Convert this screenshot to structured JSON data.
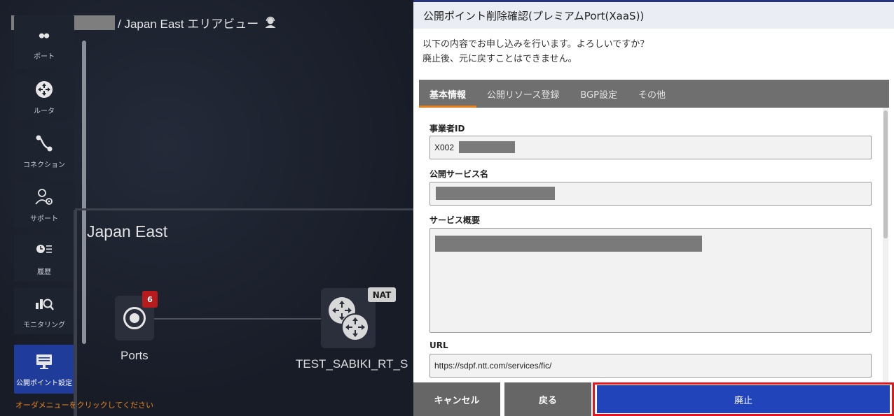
{
  "app": {
    "title": "/ Japan East エリアビュー",
    "area_name": "Japan East",
    "order_hint": "オーダメニューをクリックしてください",
    "sidebar": {
      "items": [
        {
          "label": "ポート",
          "icon": "port-icon"
        },
        {
          "label": "ルータ",
          "icon": "router-icon"
        },
        {
          "label": "コネクション",
          "icon": "connection-icon"
        },
        {
          "label": "サポート",
          "icon": "support-icon"
        },
        {
          "label": "履歴",
          "icon": "history-icon"
        },
        {
          "label": "モニタリング",
          "icon": "monitoring-icon"
        },
        {
          "label": "公開ポイント設定",
          "icon": "public-point-icon"
        }
      ],
      "active_index": 6
    },
    "nodes": {
      "ports": {
        "label": "Ports",
        "badge": "6"
      },
      "router": {
        "label": "TEST_SABIKI_RT_S",
        "badge": "NAT"
      }
    }
  },
  "modal": {
    "title": "公開ポイント削除確認(プレミアムPort(XaaS))",
    "message_lines": [
      "以下の内容でお申し込みを行います。よろしいですか？",
      "廃止後、元に戻すことはできません。"
    ],
    "tabs": [
      {
        "label": "基本情報",
        "active": true
      },
      {
        "label": "公開リソース登録",
        "active": false
      },
      {
        "label": "BGP設定",
        "active": false
      },
      {
        "label": "その他",
        "active": false
      }
    ],
    "fields": {
      "operator_id": {
        "label": "事業者ID",
        "value": "X002"
      },
      "service_name": {
        "label": "公開サービス名",
        "value": ""
      },
      "service_summary": {
        "label": "サービス概要",
        "value": ""
      },
      "url": {
        "label": "URL",
        "value": "https://sdpf.ntt.com/services/fic/"
      }
    },
    "buttons": {
      "cancel": "キャンセル",
      "back": "戻る",
      "abolish": "廃止"
    }
  },
  "colors": {
    "accent_orange": "#e8821e",
    "primary_blue": "#2244bb",
    "highlight_red": "#e0161f",
    "badge_red": "#b81b1b",
    "active_nav": "#1f3c9a"
  }
}
